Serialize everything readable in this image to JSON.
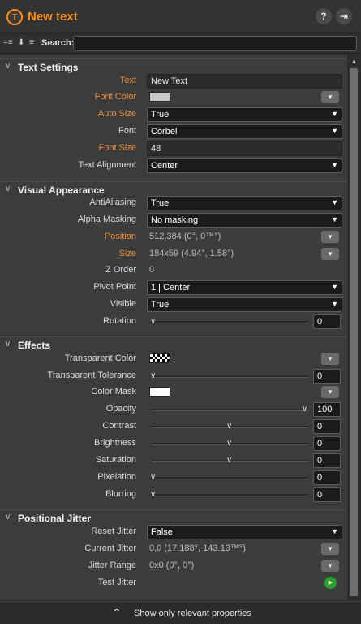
{
  "header": {
    "title": "New text",
    "app_icon": "T",
    "help_label": "?",
    "pin_label": "⇥"
  },
  "search": {
    "label": "Search:",
    "value": ""
  },
  "sections": {
    "text_settings": {
      "title": "Text Settings",
      "text_label": "Text",
      "text_value": "New Text",
      "font_color_label": "Font Color",
      "auto_size_label": "Auto Size",
      "auto_size_value": "True",
      "font_label": "Font",
      "font_value": "Corbel",
      "font_size_label": "Font Size",
      "font_size_value": "48",
      "alignment_label": "Text Alignment",
      "alignment_value": "Center"
    },
    "visual_appearance": {
      "title": "Visual Appearance",
      "antialiasing_label": "AntiAliasing",
      "antialiasing_value": "True",
      "alpha_masking_label": "Alpha Masking",
      "alpha_masking_value": "No masking",
      "position_label": "Position",
      "position_value": "512,384 (0°, 0™°)",
      "size_label": "Size",
      "size_value": "184x59 (4.94°, 1.58°)",
      "z_order_label": "Z Order",
      "z_order_value": "0",
      "pivot_label": "Pivot Point",
      "pivot_value": "1 | Center",
      "visible_label": "Visible",
      "visible_value": "True",
      "rotation_label": "Rotation",
      "rotation_value": "0"
    },
    "effects": {
      "title": "Effects",
      "transparent_color_label": "Transparent Color",
      "transparent_tolerance_label": "Transparent Tolerance",
      "transparent_tolerance_value": "0",
      "color_mask_label": "Color Mask",
      "opacity_label": "Opacity",
      "opacity_value": "100",
      "contrast_label": "Contrast",
      "contrast_value": "0",
      "brightness_label": "Brightness",
      "brightness_value": "0",
      "saturation_label": "Saturation",
      "saturation_value": "0",
      "pixelation_label": "Pixelation",
      "pixelation_value": "0",
      "blurring_label": "Blurring",
      "blurring_value": "0"
    },
    "positional_jitter": {
      "title": "Positional Jitter",
      "reset_jitter_label": "Reset Jitter",
      "reset_jitter_value": "False",
      "current_jitter_label": "Current Jitter",
      "current_jitter_value": "0,0 (17.188°, 143.13™°)",
      "jitter_range_label": "Jitter Range",
      "jitter_range_value": "0x0 (0°, 0°)",
      "test_jitter_label": "Test Jitter"
    }
  },
  "footer": {
    "label": "Show only relevant properties"
  },
  "colors": {
    "accent": "#ff8c1a",
    "label_highlight": "#f0903a",
    "font_color_swatch": "#c8c8c8",
    "color_mask_swatch": "#ffffff",
    "play": "#2aa02a"
  },
  "icons": [
    "text-app-icon",
    "help-icon",
    "pin-icon",
    "sort-icon",
    "filter-icon",
    "list-icon",
    "collapse-arrow-icon",
    "dropdown-caret-icon",
    "expand-button-icon",
    "slider-thumb-icon",
    "play-icon",
    "chevron-up-icon"
  ]
}
